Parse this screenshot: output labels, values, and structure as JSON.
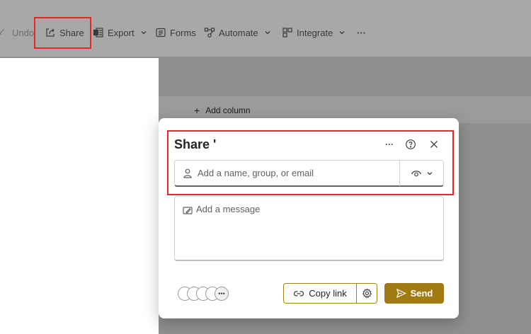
{
  "toolbar": {
    "undo_label": "Undo",
    "share_label": "Share",
    "export_label": "Export",
    "forms_label": "Forms",
    "automate_label": "Automate",
    "integrate_label": "Integrate",
    "more_label": "···"
  },
  "grid": {
    "add_column_label": "Add column"
  },
  "dialog": {
    "title": "Share '",
    "people_input": {
      "placeholder": "Add a name, group, or email"
    },
    "message_input": {
      "placeholder": "Add a message"
    },
    "copy_link_label": "Copy link",
    "send_label": "Send",
    "more_label": "···"
  },
  "colors": {
    "highlight": "#e8262b",
    "accent": "#a17a13"
  }
}
